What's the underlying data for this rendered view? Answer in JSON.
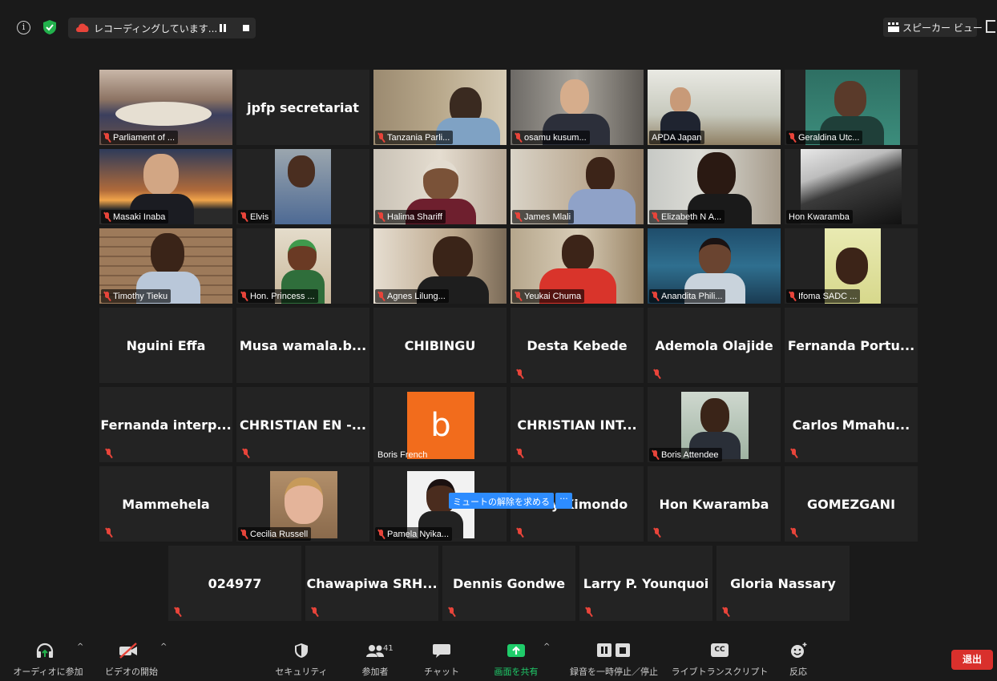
{
  "topbar": {
    "recording_label": "レコーディングしています...",
    "speaker_view_label": "スピーカー ビュー"
  },
  "participants": {
    "t1": "Parliament of ...",
    "t2": "jpfp secretariat",
    "t3": "Tanzania Parli...",
    "t4": "osamu kusum...",
    "t5": "APDA Japan",
    "t6": "Geraldina Utc...",
    "t7": "Masaki Inaba",
    "t8": "Elvis",
    "t9": "Halima Shariff",
    "t10": "James Mlali",
    "t11": "Elizabeth N A...",
    "t12": "Hon Kwaramba",
    "t13": "Timothy Tieku",
    "t14": "Hon. Princess ...",
    "t15": "Agnes Lilung...",
    "t16": "Yeukai Chuma",
    "t17": "Anandita Phili...",
    "t18": "Ifoma  SADC ...",
    "t19": "Nguini Effa",
    "t20": "Musa  wamala.b...",
    "t21": "CHIBINGU",
    "t22": "Desta Kebede",
    "t23": "Ademola Olajide",
    "t24": "Fernanda Portu...",
    "t25": "Fernanda interp...",
    "t26": "CHRISTIAN EN -...",
    "t27": "Boris French",
    "t27_avatar_letter": "b",
    "t28": "CHRISTIAN  INT...",
    "t29": "Boris Attendee",
    "t30": "Carlos  Mmahu...",
    "t31": "Mammehela",
    "t32": "Cecilia Russell",
    "t33": "Pamela Nyika...",
    "t34": "Lucy Kimondo",
    "t35": "Hon Kwaramba",
    "t36": "GOMEZGANI",
    "t37": "024977",
    "t38": "Chawapiwa  SRH...",
    "t39": "Dennis Gondwe",
    "t40": "Larry P. Younquoi",
    "t41": "Gloria Nassary"
  },
  "unmute_request": {
    "label": "ミュートの解除を求める",
    "more": "···"
  },
  "toolbar": {
    "audio": "オーディオに参加",
    "video": "ビデオの開始",
    "security": "セキュリティ",
    "participants": "参加者",
    "participants_count": "41",
    "chat": "チャット",
    "share": "画面を共有",
    "record": "録音を一時停止／停止",
    "transcript": "ライブトランスクリプト",
    "transcript_icon": "CC",
    "reactions": "反応",
    "exit": "退出"
  },
  "colors": {
    "active_speaker": "#c8e87e",
    "muted_mic": "#e8443a",
    "share_green": "#1fcc6a",
    "exit_red": "#d9302c",
    "request_blue": "#2d8cff",
    "avatar_orange": "#f26c1c"
  }
}
